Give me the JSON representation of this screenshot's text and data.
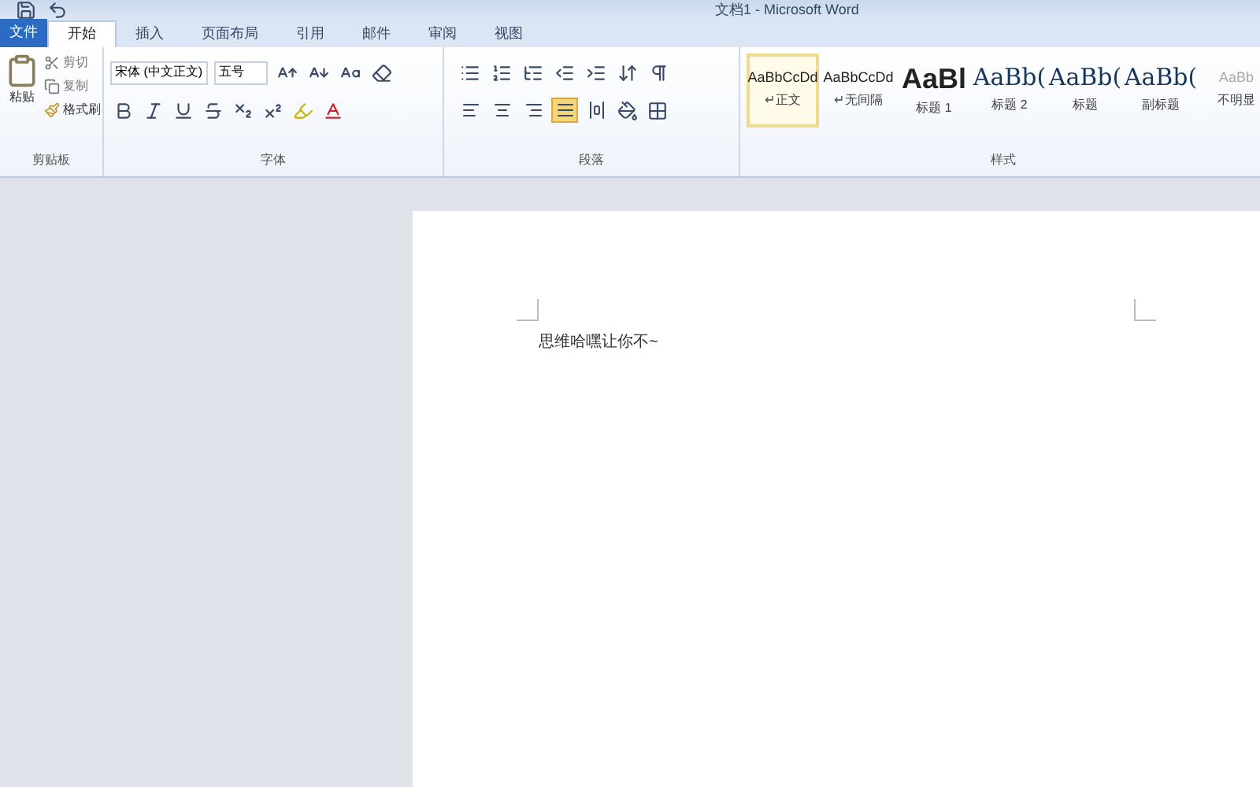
{
  "window": {
    "title": "文档1 - Microsoft Word"
  },
  "tabs": [
    {
      "label": "文件",
      "kind": "file",
      "selected": false
    },
    {
      "label": "开始",
      "kind": "tab",
      "selected": true
    },
    {
      "label": "插入",
      "kind": "tab",
      "selected": false
    },
    {
      "label": "页面布局",
      "kind": "tab",
      "selected": false
    },
    {
      "label": "引用",
      "kind": "tab",
      "selected": false
    },
    {
      "label": "邮件",
      "kind": "tab",
      "selected": false
    },
    {
      "label": "审阅",
      "kind": "tab",
      "selected": false
    },
    {
      "label": "视图",
      "kind": "tab",
      "selected": false
    }
  ],
  "clipboard": {
    "paste": "粘贴",
    "cut": "剪切",
    "copy": "复制",
    "format_painter": "格式刷",
    "group_label": "剪贴板"
  },
  "font": {
    "font_name": "宋体 (中文正文)",
    "font_size": "五号",
    "group_label": "字体"
  },
  "paragraph": {
    "align_buttons": [
      {
        "kind": "left",
        "selected": false
      },
      {
        "kind": "center",
        "selected": false
      },
      {
        "kind": "right",
        "selected": false
      },
      {
        "kind": "justify",
        "selected": true
      },
      {
        "kind": "distributed",
        "selected": false
      }
    ],
    "group_label": "段落"
  },
  "styles": {
    "items": [
      {
        "preview": "AaBbCcDd",
        "label": "↵正文",
        "kind": "small",
        "selected": true
      },
      {
        "preview": "AaBbCcDd",
        "label": "↵无间隔",
        "kind": "small",
        "selected": false
      },
      {
        "preview": "AaBl",
        "label": "标题 1",
        "kind": "heavy",
        "selected": false
      },
      {
        "preview": "AaBb(",
        "label": "标题 2",
        "kind": "large",
        "selected": false
      },
      {
        "preview": "AaBb(",
        "label": "标题",
        "kind": "large",
        "selected": false
      },
      {
        "preview": "AaBb(",
        "label": "副标题",
        "kind": "large",
        "selected": false
      },
      {
        "preview": "AaBb",
        "label": "不明显",
        "kind": "faint",
        "selected": false
      }
    ],
    "group_label": "样式"
  },
  "document": {
    "text": "思维哈嘿让你不~"
  }
}
